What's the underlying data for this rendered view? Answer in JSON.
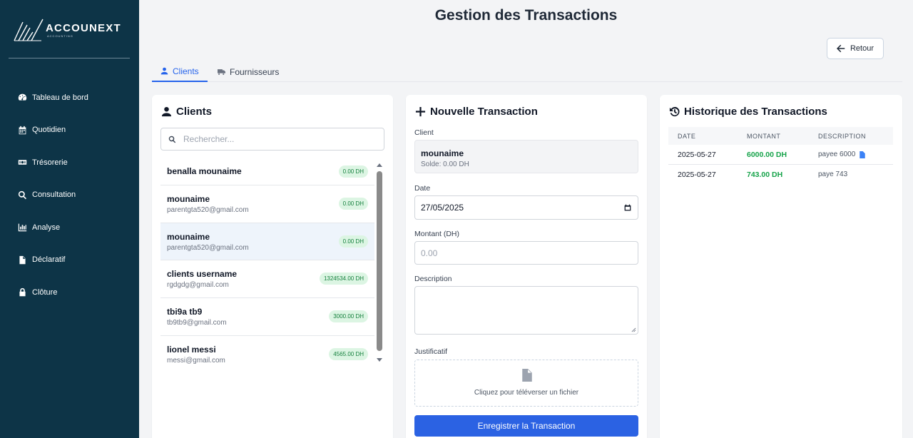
{
  "brand": {
    "name": "ACCOUNEXT",
    "subtitle": "ACCOUNTING"
  },
  "sidebar": {
    "items": [
      {
        "label": "Tableau de bord",
        "icon": "dashboard-icon"
      },
      {
        "label": "Quotidien",
        "icon": "calendar-icon"
      },
      {
        "label": "Trésorerie",
        "icon": "money-icon"
      },
      {
        "label": "Consultation",
        "icon": "search-icon"
      },
      {
        "label": "Analyse",
        "icon": "chart-icon"
      },
      {
        "label": "Déclaratif",
        "icon": "file-icon"
      },
      {
        "label": "Clôture",
        "icon": "lock-icon"
      }
    ]
  },
  "header": {
    "title": "Gestion des Transactions",
    "back_label": "Retour"
  },
  "tabs": [
    {
      "label": "Clients",
      "active": true
    },
    {
      "label": "Fournisseurs",
      "active": false
    }
  ],
  "clients_panel": {
    "title": "Clients",
    "search_placeholder": "Rechercher...",
    "items": [
      {
        "name": "benalla mounaime",
        "email": "",
        "balance": "0.00 DH"
      },
      {
        "name": "mounaime",
        "email": "parentgta520@gmail.com",
        "balance": "0.00 DH"
      },
      {
        "name": "mounaime",
        "email": "parentgta520@gmail.com",
        "balance": "0.00 DH",
        "selected": true
      },
      {
        "name": "clients username",
        "email": "rgdgdg@gmail.com",
        "balance": "1324534.00 DH"
      },
      {
        "name": "tbi9a tb9",
        "email": "tb9tb9@gmail.com",
        "balance": "3000.00 DH"
      },
      {
        "name": "lionel messi",
        "email": "messi@gmail.com",
        "balance": "4565.00 DH"
      }
    ]
  },
  "transaction_form": {
    "title": "Nouvelle Transaction",
    "client_label": "Client",
    "client_name": "mounaime",
    "client_balance": "Solde: 0.00 DH",
    "date_label": "Date",
    "date_value": "27/05/2025",
    "amount_label": "Montant (DH)",
    "amount_placeholder": "0.00",
    "description_label": "Description",
    "justificatif_label": "Justificatif",
    "upload_text": "Cliquez pour téléverser un fichier",
    "submit_label": "Enregistrer la Transaction"
  },
  "history": {
    "title": "Historique des Transactions",
    "columns": [
      "DATE",
      "MONTANT",
      "DESCRIPTION"
    ],
    "rows": [
      {
        "date": "2025-05-27",
        "amount": "6000.00 DH",
        "description": "payee 6000",
        "has_file": true
      },
      {
        "date": "2025-05-27",
        "amount": "743.00 DH",
        "description": "paye 743",
        "has_file": false
      }
    ]
  },
  "colors": {
    "sidebar": "#0d3447",
    "accent": "#2563eb",
    "success": "#16a34a"
  }
}
